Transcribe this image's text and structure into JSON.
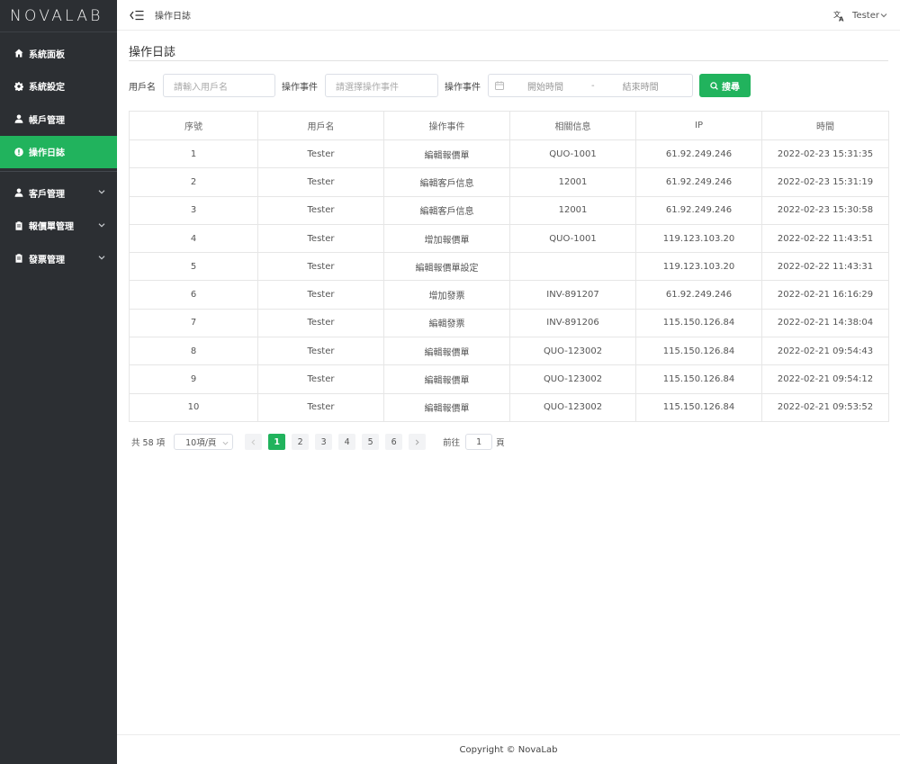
{
  "app": {
    "logo": "NOVALAB"
  },
  "sidebar": {
    "items": [
      {
        "label": "系統面板",
        "icon": "home-icon"
      },
      {
        "label": "系統設定",
        "icon": "gear-icon"
      },
      {
        "label": "帳戶管理",
        "icon": "user-icon"
      },
      {
        "label": "操作日誌",
        "icon": "alert-circle-icon",
        "active": true
      },
      {
        "label": "客戶管理",
        "icon": "user-icon"
      },
      {
        "label": "報價單管理",
        "icon": "clipboard-icon"
      },
      {
        "label": "發票管理",
        "icon": "clipboard-icon"
      }
    ]
  },
  "header": {
    "breadcrumb": "操作日誌",
    "user": "Tester",
    "language_icon": "translate-icon"
  },
  "page": {
    "title": "操作日誌"
  },
  "filters": {
    "username_label": "用戶名",
    "username_placeholder": "請輸入用戶名",
    "event_label": "操作事件",
    "event_placeholder": "請選擇操作事件",
    "date_label": "操作事件",
    "start_placeholder": "開始時間",
    "separator": "-",
    "end_placeholder": "結束時間",
    "search_label": "搜尋"
  },
  "table": {
    "headers": [
      "序號",
      "用戶名",
      "操作事件",
      "相關信息",
      "IP",
      "時間"
    ],
    "rows": [
      [
        "1",
        "Tester",
        "編輯報價單",
        "QUO-1001",
        "61.92.249.246",
        "2022-02-23 15:31:35"
      ],
      [
        "2",
        "Tester",
        "編輯客戶信息",
        "12001",
        "61.92.249.246",
        "2022-02-23 15:31:19"
      ],
      [
        "3",
        "Tester",
        "編輯客戶信息",
        "12001",
        "61.92.249.246",
        "2022-02-23 15:30:58"
      ],
      [
        "4",
        "Tester",
        "增加報價單",
        "QUO-1001",
        "119.123.103.20",
        "2022-02-22 11:43:51"
      ],
      [
        "5",
        "Tester",
        "編輯報價單設定",
        "",
        "119.123.103.20",
        "2022-02-22 11:43:31"
      ],
      [
        "6",
        "Tester",
        "增加發票",
        "INV-891207",
        "61.92.249.246",
        "2022-02-21 16:16:29"
      ],
      [
        "7",
        "Tester",
        "編輯發票",
        "INV-891206",
        "115.150.126.84",
        "2022-02-21 14:38:04"
      ],
      [
        "8",
        "Tester",
        "編輯報價單",
        "QUO-123002",
        "115.150.126.84",
        "2022-02-21 09:54:43"
      ],
      [
        "9",
        "Tester",
        "編輯報價單",
        "QUO-123002",
        "115.150.126.84",
        "2022-02-21 09:54:12"
      ],
      [
        "10",
        "Tester",
        "編輯報價單",
        "QUO-123002",
        "115.150.126.84",
        "2022-02-21 09:53:52"
      ]
    ]
  },
  "pagination": {
    "total": "共 58 項",
    "page_size": "10項/頁",
    "pages": [
      "1",
      "2",
      "3",
      "4",
      "5",
      "6"
    ],
    "current": "1",
    "goto_label": "前往",
    "goto_value": "1",
    "goto_suffix": "頁"
  },
  "footer": {
    "copyright": "Copyright © NovaLab"
  },
  "colors": {
    "accent": "#21b35d",
    "sidebar_bg": "#2c2f33"
  }
}
